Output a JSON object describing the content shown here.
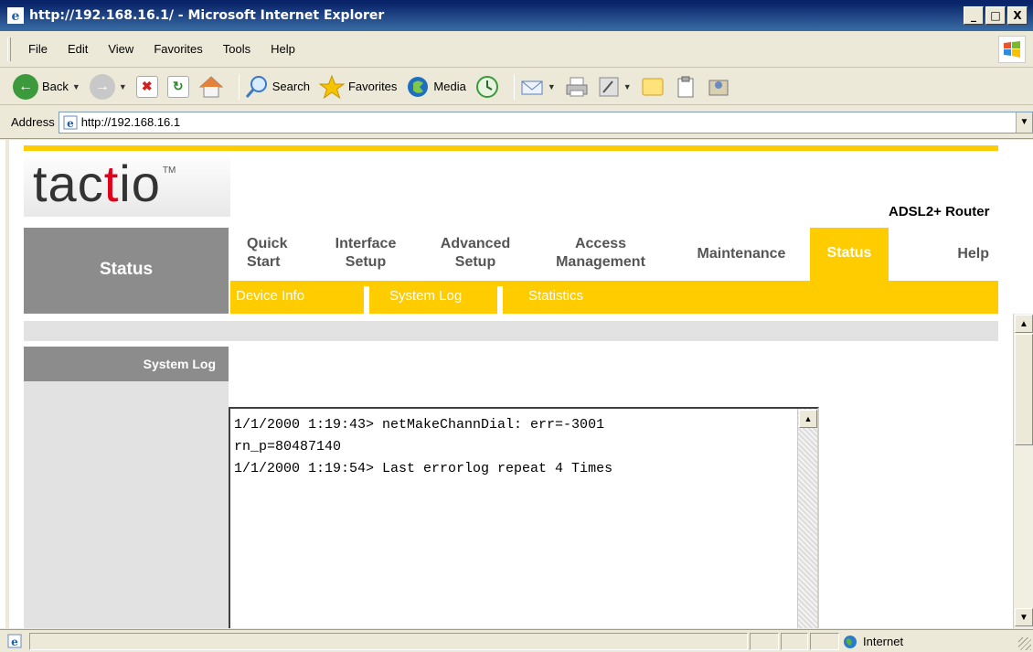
{
  "window": {
    "title": "http://192.168.16.1/ - Microsoft Internet Explorer",
    "buttons": {
      "minimize": "_",
      "maximize": "□",
      "close": "X"
    }
  },
  "menubar": {
    "items": [
      "File",
      "Edit",
      "View",
      "Favorites",
      "Tools",
      "Help"
    ]
  },
  "toolbar": {
    "back": "Back",
    "search": "Search",
    "favorites": "Favorites",
    "media": "Media"
  },
  "address": {
    "label": "Address",
    "url": "http://192.168.16.1"
  },
  "page": {
    "logo": {
      "part1": "tac",
      "part2": "t",
      "part3": "io",
      "tm": "TM"
    },
    "product": "ADSL2+ Router",
    "section": "Status",
    "nav": [
      "Quick\nStart",
      "Interface\nSetup",
      "Advanced\nSetup",
      "Access\nManagement",
      "Maintenance",
      "Status",
      "Help"
    ],
    "subnav": [
      "Device Info",
      "System Log",
      "Statistics"
    ],
    "side_label": "System Log",
    "log": "1/1/2000 1:19:43> netMakeChannDial: err=-3001\nrn_p=80487140\n1/1/2000 1:19:54> Last errorlog repeat 4 Times"
  },
  "statusbar": {
    "zone": "Internet"
  },
  "colors": {
    "accent": "#ffcc00",
    "brand_red": "#e0001a",
    "panel_grey": "#8c8c8c"
  }
}
